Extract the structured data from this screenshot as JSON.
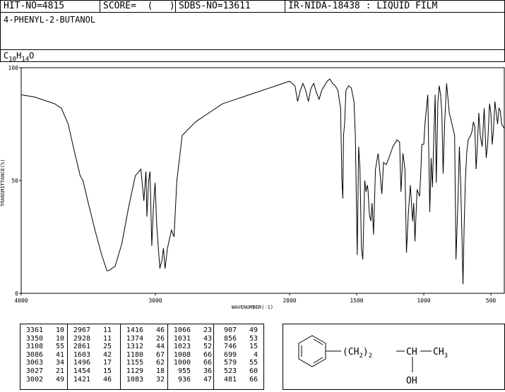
{
  "header": {
    "hit_no": "HIT-NO=4815",
    "score": "SCORE=  (   )",
    "sdbs_no": "SDBS-NO=13611",
    "ir_info": "IR-NIDA-18438 : LIQUID FILM"
  },
  "compound_name": "4-PHENYL-2-BUTANOL",
  "formula": {
    "c": "C",
    "c_sub": "10",
    "h": "H",
    "h_sub": "14",
    "o": "O"
  },
  "chart_data": {
    "type": "line",
    "xlabel": "WAVENUMBER(-1)",
    "ylabel": "TRANSMITTANCE(%)",
    "xlim": [
      4000,
      400
    ],
    "ylim": [
      0,
      100
    ],
    "x_ticks": [
      4000,
      3000,
      2000,
      1500,
      1000,
      500
    ],
    "y_ticks": [
      0,
      50,
      100
    ],
    "grid": false,
    "series": [
      {
        "x": [
          4000,
          3900,
          3800,
          3750,
          3700,
          3650,
          3600,
          3560,
          3540,
          3500,
          3450,
          3400,
          3361,
          3350,
          3300,
          3250,
          3200,
          3150,
          3108,
          3086,
          3070,
          3063,
          3050,
          3040,
          3027,
          3015,
          3002,
          2990,
          2967,
          2950,
          2940,
          2928,
          2910,
          2880,
          2861,
          2840,
          2800,
          2700,
          2600,
          2500,
          2400,
          2300,
          2200,
          2100,
          2050,
          2000,
          1960,
          1940,
          1920,
          1900,
          1880,
          1860,
          1840,
          1820,
          1800,
          1780,
          1760,
          1740,
          1720,
          1700,
          1680,
          1660,
          1640,
          1620,
          1610,
          1603,
          1598,
          1590,
          1580,
          1560,
          1540,
          1520,
          1510,
          1496,
          1485,
          1475,
          1465,
          1454,
          1440,
          1430,
          1421,
          1416,
          1405,
          1395,
          1385,
          1374,
          1360,
          1340,
          1312,
          1300,
          1280,
          1260,
          1230,
          1200,
          1180,
          1170,
          1155,
          1140,
          1129,
          1115,
          1100,
          1083,
          1075,
          1066,
          1050,
          1031,
          1023,
          1015,
          1008,
          1000,
          990,
          980,
          970,
          955,
          945,
          936,
          925,
          915,
          907,
          895,
          885,
          875,
          865,
          856,
          845,
          830,
          810,
          790,
          770,
          760,
          746,
          735,
          725,
          715,
          708,
          699,
          690,
          680,
          670,
          660,
          650,
          640,
          630,
          620,
          610,
          600,
          590,
          579,
          565,
          550,
          535,
          523,
          510,
          500,
          490,
          481,
          470,
          460,
          450,
          440,
          430,
          420,
          410,
          400
        ],
        "y": [
          88,
          87,
          85,
          84,
          82,
          75,
          62,
          52,
          50,
          40,
          28,
          17,
          10,
          10,
          12,
          22,
          38,
          52,
          55,
          41,
          54,
          34,
          50,
          54,
          21,
          38,
          49,
          30,
          11,
          15,
          20,
          11,
          20,
          28,
          25,
          50,
          70,
          76,
          80,
          84,
          86,
          88,
          90,
          92,
          93,
          94,
          92,
          85,
          90,
          93,
          90,
          85,
          91,
          93,
          89,
          86,
          90,
          92,
          94,
          95,
          93,
          92,
          90,
          82,
          50,
          42,
          70,
          75,
          90,
          92,
          91,
          85,
          70,
          17,
          65,
          55,
          20,
          15,
          50,
          45,
          48,
          46,
          35,
          32,
          40,
          26,
          55,
          62,
          44,
          58,
          57,
          60,
          65,
          68,
          67,
          45,
          62,
          55,
          18,
          35,
          48,
          32,
          40,
          23,
          46,
          43,
          52,
          66,
          66,
          66,
          76,
          82,
          88,
          36,
          60,
          47,
          70,
          88,
          49,
          85,
          92,
          88,
          80,
          53,
          75,
          93,
          80,
          75,
          70,
          15,
          40,
          65,
          48,
          25,
          4,
          30,
          50,
          62,
          68,
          69,
          70,
          72,
          76,
          74,
          55,
          66,
          80,
          70,
          65,
          82,
          60,
          67,
          84,
          80,
          66,
          72,
          85,
          80,
          75,
          82,
          81,
          75,
          74,
          73
        ]
      }
    ]
  },
  "peak_table": [
    [
      [
        "3361",
        "10"
      ],
      [
        "3350",
        "10"
      ],
      [
        "3108",
        "55"
      ],
      [
        "3086",
        "41"
      ],
      [
        "3063",
        "34"
      ],
      [
        "3027",
        "21"
      ],
      [
        "3002",
        "49"
      ]
    ],
    [
      [
        "2967",
        "11"
      ],
      [
        "2928",
        "11"
      ],
      [
        "2861",
        "25"
      ],
      [
        "1603",
        "42"
      ],
      [
        "1496",
        "17"
      ],
      [
        "1454",
        "15"
      ],
      [
        "1421",
        "46"
      ]
    ],
    [
      [
        "1416",
        "46"
      ],
      [
        "1374",
        "26"
      ],
      [
        "1312",
        "44"
      ],
      [
        "1180",
        "67"
      ],
      [
        "1155",
        "62"
      ],
      [
        "1129",
        "18"
      ],
      [
        "1083",
        "32"
      ]
    ],
    [
      [
        "1066",
        "23"
      ],
      [
        "1031",
        "43"
      ],
      [
        "1023",
        "52"
      ],
      [
        "1008",
        "66"
      ],
      [
        "1000",
        "66"
      ],
      [
        "955",
        "36"
      ],
      [
        "936",
        "47"
      ]
    ],
    [
      [
        "907",
        "49"
      ],
      [
        "856",
        "53"
      ],
      [
        "746",
        "15"
      ],
      [
        "699",
        "4"
      ],
      [
        "579",
        "55"
      ],
      [
        "523",
        "60"
      ],
      [
        "481",
        "66"
      ]
    ]
  ],
  "structure": {
    "chain": "(CH",
    "chain_sub": "2",
    "chain_close": ")",
    "chain_count": "2",
    "ch": "CH",
    "ch3": "CH",
    "ch3_sub": "3",
    "oh": "OH"
  }
}
